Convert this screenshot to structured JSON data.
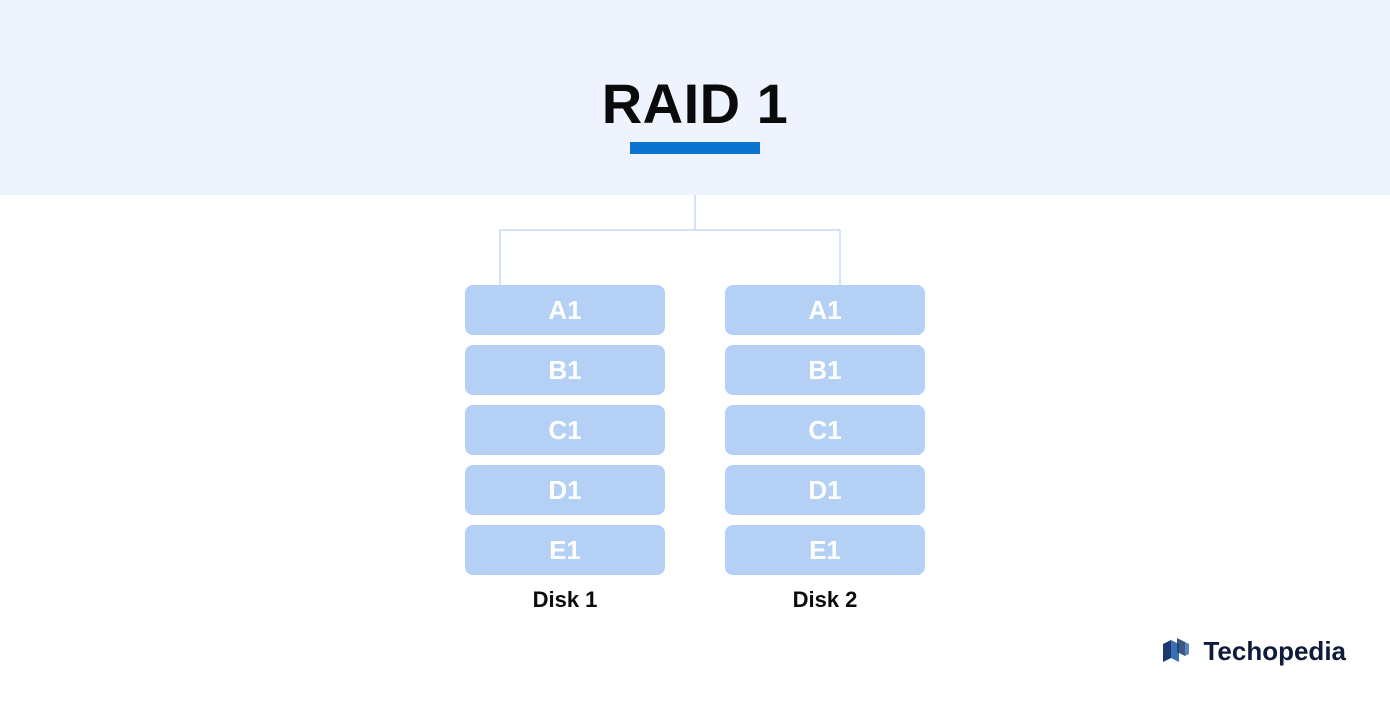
{
  "title": "RAID 1",
  "disks": [
    {
      "label": "Disk 1",
      "blocks": [
        "A1",
        "B1",
        "C1",
        "D1",
        "E1"
      ]
    },
    {
      "label": "Disk 2",
      "blocks": [
        "A1",
        "B1",
        "C1",
        "D1",
        "E1"
      ]
    }
  ],
  "brand": "Techopedia",
  "colors": {
    "header_bg": "#eef3fe",
    "accent": "#0a74d0",
    "block_bg": "#b4d0f5",
    "block_text": "#ffffff",
    "connector": "#c8d9f5",
    "brand_text": "#0f1b3a",
    "brand_icon_dark": "#1a3a6b",
    "brand_icon_light": "#3b6fb5"
  }
}
